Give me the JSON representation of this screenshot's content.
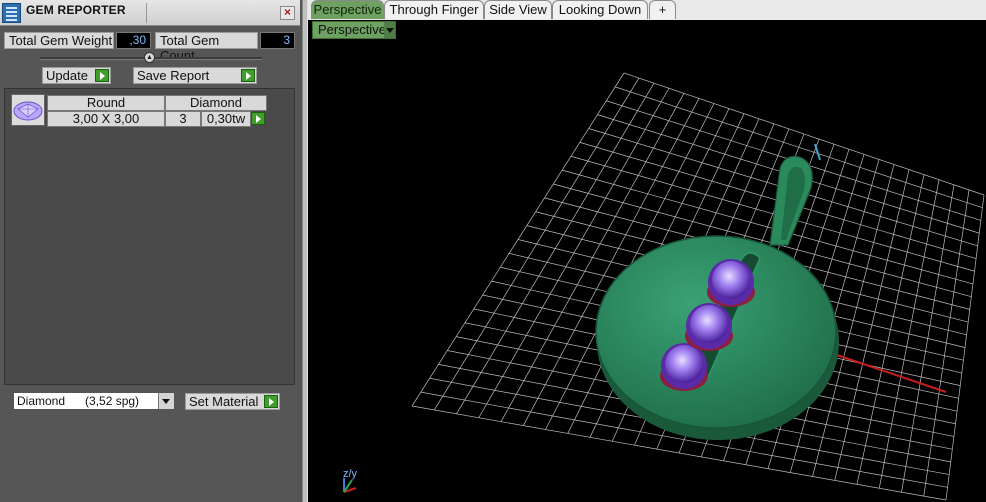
{
  "panel": {
    "title": "GEM REPORTER",
    "close_label": "×",
    "weight_label": "Total Gem Weight",
    "weight_value": ",30",
    "count_label": "Total Gem Count",
    "count_value": "3",
    "update_label": "Update",
    "save_label": "Save Report",
    "gem_table": {
      "shape_header": "Round",
      "type_header": "Diamond",
      "rows": [
        {
          "size": "3,00 X 3,00",
          "count": "3",
          "weight": "0,30tw"
        }
      ]
    },
    "material_value": "Diamond      (3,52 spg)",
    "set_material_label": "Set Material"
  },
  "viewport": {
    "tabs": [
      "Perspective",
      "Through Finger",
      "Side View",
      "Looking Down"
    ],
    "active_tab": "Perspective",
    "add_tab_label": "+",
    "view_select": "Perspective",
    "axis_label": "z/y"
  },
  "colors": {
    "panel_bg": "#565656",
    "tab_active": "#6da061",
    "metal": "#2e8a5e",
    "gem": "#8a4fd6",
    "grid": "#bdbdbd",
    "x_axis": "#c81e1e"
  },
  "icons": {
    "app": "gem-reporter-icon",
    "close": "close-icon",
    "go": "play-arrow-icon",
    "dropdown": "chevron-down-icon",
    "gem_thumb": "round-gem-icon"
  }
}
